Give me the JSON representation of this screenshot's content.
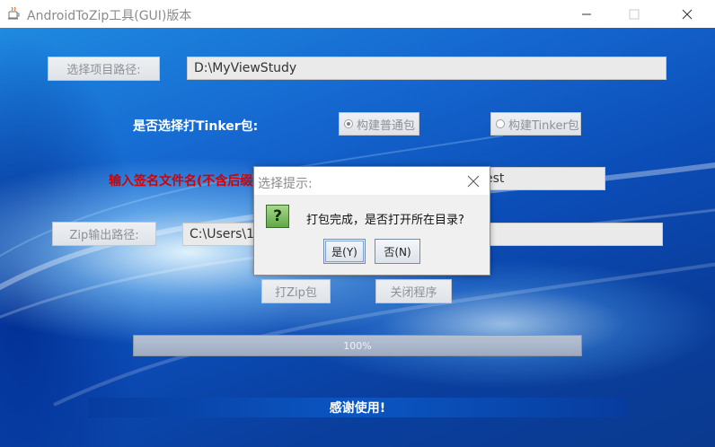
{
  "window": {
    "title": "AndroidToZip工具(GUI)版本",
    "controls": [
      "minimize-icon",
      "maximize-icon",
      "close-icon"
    ]
  },
  "form": {
    "select_project_label": "选择项目路径:",
    "project_path_value": "D:\\MyViewStudy",
    "tinker_question": "是否选择打Tinker包:",
    "radio_normal_label": "构建普通包",
    "radio_tinker_label": "构建Tinker包",
    "radio_selected": "构建普通包",
    "sign_file_label": "输入签名文件名(不含后缀",
    "sign_file_value": "est",
    "zip_output_label": "Zip输出路径:",
    "zip_output_value": "C:\\Users\\1",
    "build_zip_label": "打Zip包",
    "close_program_label": "关闭程序"
  },
  "progress": {
    "percent": 100,
    "text": "100%"
  },
  "footer": {
    "thanks_text": "感谢使用!"
  },
  "dialog": {
    "title": "选择提示:",
    "icon": "question-icon",
    "icon_glyph": "?",
    "message": "打包完成，是否打开所在目录?",
    "yes_label": "是(Y)",
    "no_label": "否(N)"
  },
  "colors": {
    "background": "#0a3d9c",
    "label_text": "#ffffff",
    "sign_label": "#d40000",
    "question_icon": "#5fa844"
  }
}
